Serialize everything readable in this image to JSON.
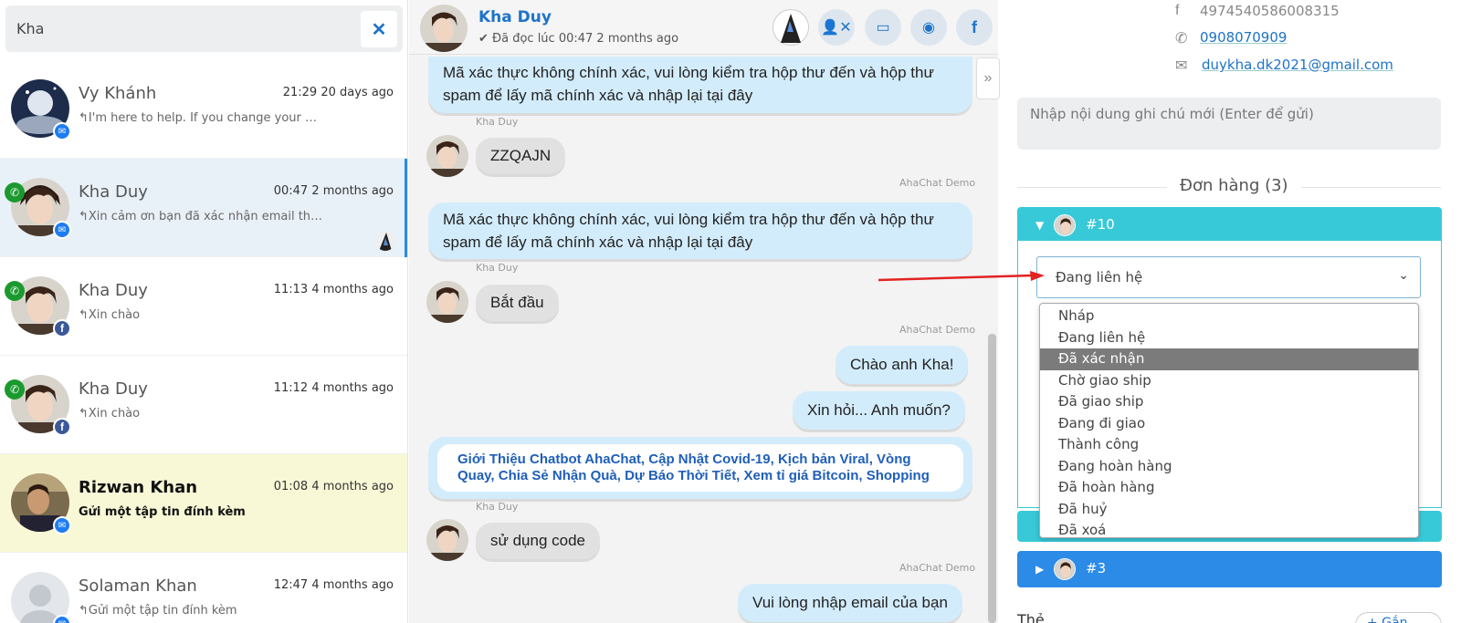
{
  "search": {
    "value": "Kha"
  },
  "conversations": [
    {
      "name": "Vy Khánh",
      "time": "21:29 20 days ago",
      "preview": "I'm here to help. If you change your m…",
      "channel": "messenger"
    },
    {
      "name": "Kha Duy",
      "time": "00:47 2 months ago",
      "preview": "Xin cảm ơn bạn đã xác nhận email th…",
      "channel": "messenger",
      "active": true
    },
    {
      "name": "Kha Duy",
      "time": "11:13 4 months ago",
      "preview": "Xin chào",
      "channel": "facebook"
    },
    {
      "name": "Kha Duy",
      "time": "11:12 4 months ago",
      "preview": "Xin chào",
      "channel": "facebook"
    },
    {
      "name": "Rizwan Khan",
      "time": "01:08 4 months ago",
      "preview": "Gửi một tập tin đính kèm",
      "channel": "messenger",
      "unread": true
    },
    {
      "name": "Solaman Khan",
      "time": "12:47 4 months ago",
      "preview": "Gửi một tập tin đính kèm",
      "channel": "messenger"
    }
  ],
  "chat": {
    "name": "Kha Duy",
    "read_status": "Đã đọc lúc 00:47 2 months ago",
    "messages": [
      {
        "dir": "out",
        "text": "Mã xác thực không chính xác, vui lòng kiểm tra hộp thư đến và hộp thư spam để lấy mã chính xác và nhập lại tại đây"
      },
      {
        "label": "Kha Duy"
      },
      {
        "dir": "in",
        "text": "ZZQAJN"
      },
      {
        "label": "AhaChat Demo"
      },
      {
        "dir": "out",
        "text": "Mã xác thực không chính xác, vui lòng kiểm tra hộp thư đến và hộp thư spam để lấy mã chính xác và nhập lại tại đây"
      },
      {
        "label": "Kha Duy"
      },
      {
        "dir": "in",
        "text": "Bắt đầu"
      },
      {
        "label": "AhaChat Demo"
      },
      {
        "dir": "out",
        "text": "Chào anh Kha!"
      },
      {
        "dir": "out",
        "text": "Xin hỏi... Anh muốn?"
      },
      {
        "dir": "out",
        "text": "Giới Thiệu Chatbot AhaChat, Cập Nhật Covid-19, Kịch bản Viral, Vòng Quay, Chia Sẻ Nhận Quà, Dự Báo Thời Tiết, Xem tỉ giá Bitcoin, Shopping"
      },
      {
        "label": "Kha Duy"
      },
      {
        "dir": "in",
        "text": "sử dụng code"
      },
      {
        "label": "AhaChat Demo"
      },
      {
        "dir": "out",
        "text": "Vui lòng nhập email của bạn"
      }
    ]
  },
  "contact": {
    "facebook_id": "4974540586008315",
    "phone": "0908070909",
    "email": "duykha.dk2021@gmail.com"
  },
  "note": {
    "placeholder": "Nhập nội dung ghi chú mới (Enter để gửi)"
  },
  "orders": {
    "title": "Đơn hàng (3)",
    "items": [
      {
        "number": "#10",
        "color": "#38c9d8"
      },
      {
        "number": "#3",
        "color": "#2b8be6"
      }
    ],
    "status_selected": "Đang liên hệ",
    "status_options": [
      "Nháp",
      "Đang liên hệ",
      "Đã xác nhận",
      "Chờ giao ship",
      "Đã giao ship",
      "Đang đi giao",
      "Thành công",
      "Đang hoàn hàng",
      "Đã hoàn hàng",
      "Đã huỷ",
      "Đã xoá"
    ],
    "highlighted_option": "Đã xác nhận"
  },
  "tags": {
    "title": "Thẻ",
    "add_label": "+ Gắn thẻ"
  }
}
